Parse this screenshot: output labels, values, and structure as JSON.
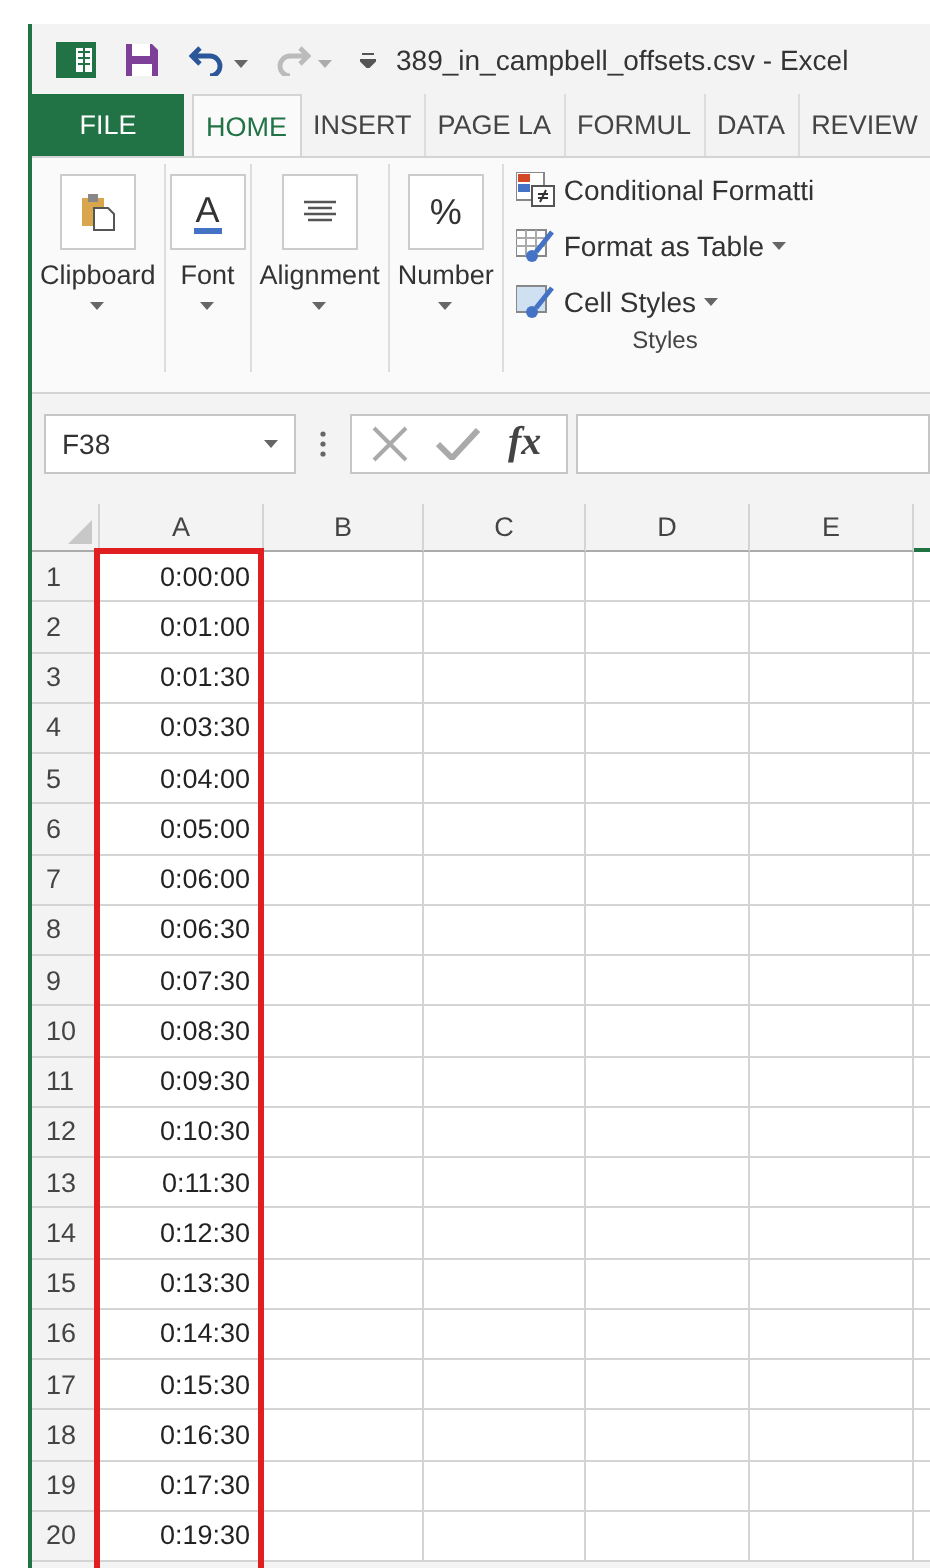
{
  "title_bar": {
    "title": "389_in_campbell_offsets.csv - Excel"
  },
  "tabs": [
    {
      "label": "FILE",
      "kind": "file",
      "selected": false
    },
    {
      "label": "HOME",
      "kind": "tab",
      "selected": true
    },
    {
      "label": "INSERT",
      "kind": "tab",
      "selected": false
    },
    {
      "label": "PAGE LA",
      "kind": "tab",
      "selected": false
    },
    {
      "label": "FORMUL",
      "kind": "tab",
      "selected": false
    },
    {
      "label": "DATA",
      "kind": "tab",
      "selected": false
    },
    {
      "label": "REVIEW",
      "kind": "tab",
      "selected": false
    }
  ],
  "ribbon": {
    "groups": [
      {
        "label": "Clipboard",
        "kind": "collapsed"
      },
      {
        "label": "Font",
        "kind": "collapsed",
        "glyph": "A"
      },
      {
        "label": "Alignment",
        "kind": "collapsed"
      },
      {
        "label": "Number",
        "kind": "collapsed",
        "glyph": "%"
      },
      {
        "label": "Styles",
        "kind": "list",
        "items": [
          {
            "label": "Conditional Formatti",
            "dropdown": false
          },
          {
            "label": "Format as Table",
            "dropdown": true
          },
          {
            "label": "Cell Styles",
            "dropdown": true
          }
        ]
      }
    ]
  },
  "formula_bar": {
    "name_box": "F38",
    "fx": "fx"
  },
  "grid": {
    "columns": [
      {
        "label": "A",
        "highlighted": true
      },
      {
        "label": "B",
        "highlighted": false
      },
      {
        "label": "C",
        "highlighted": false
      },
      {
        "label": "D",
        "highlighted": false
      },
      {
        "label": "E",
        "highlighted": false
      }
    ],
    "rows": [
      {
        "number": "1",
        "cells": [
          "0:00:00"
        ]
      },
      {
        "number": "2",
        "cells": [
          "0:01:00"
        ]
      },
      {
        "number": "3",
        "cells": [
          "0:01:30"
        ]
      },
      {
        "number": "4",
        "cells": [
          "0:03:30"
        ]
      },
      {
        "number": "5",
        "cells": [
          "0:04:00"
        ]
      },
      {
        "number": "6",
        "cells": [
          "0:05:00"
        ]
      },
      {
        "number": "7",
        "cells": [
          "0:06:00"
        ]
      },
      {
        "number": "8",
        "cells": [
          "0:06:30"
        ]
      },
      {
        "number": "9",
        "cells": [
          "0:07:30"
        ]
      },
      {
        "number": "10",
        "cells": [
          "0:08:30"
        ]
      },
      {
        "number": "11",
        "cells": [
          "0:09:30"
        ]
      },
      {
        "number": "12",
        "cells": [
          "0:10:30"
        ]
      },
      {
        "number": "13",
        "cells": [
          "0:11:30"
        ]
      },
      {
        "number": "14",
        "cells": [
          "0:12:30"
        ]
      },
      {
        "number": "15",
        "cells": [
          "0:13:30"
        ]
      },
      {
        "number": "16",
        "cells": [
          "0:14:30"
        ]
      },
      {
        "number": "17",
        "cells": [
          "0:15:30"
        ]
      },
      {
        "number": "18",
        "cells": [
          "0:16:30"
        ]
      },
      {
        "number": "19",
        "cells": [
          "0:17:30"
        ]
      },
      {
        "number": "20",
        "cells": [
          "0:19:30"
        ]
      }
    ]
  }
}
